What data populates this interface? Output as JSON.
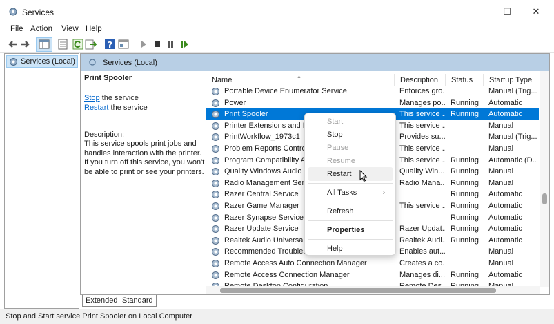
{
  "window": {
    "title": "Services",
    "icon": "services-gear-icon",
    "minimize_icon": "—",
    "maximize_icon": "☐",
    "close_icon": "✕"
  },
  "menu": [
    "File",
    "Action",
    "View",
    "Help"
  ],
  "toolbar": [
    "back-arrow-icon",
    "forward-arrow-icon",
    "console-tree-icon",
    "properties-icon",
    "refresh-icon",
    "export-list-icon",
    "help-icon",
    "view-icon",
    "start-service-icon",
    "stop-service-icon",
    "pause-service-icon",
    "resume-service-icon"
  ],
  "tree": {
    "label": "Services (Local)"
  },
  "pane": {
    "title": "Services (Local)"
  },
  "extended": {
    "service_name": "Print Spooler",
    "stop_link": "Stop",
    "stop_suffix": " the service",
    "restart_link": "Restart",
    "restart_suffix": " the service",
    "description_label": "Description:",
    "description": "This service spools print jobs and handles interaction with the printer. If you turn off this service, you won't be able to print or see your printers."
  },
  "columns": {
    "name": "Name",
    "description": "Description",
    "status": "Status",
    "startup": "Startup Type"
  },
  "rows": [
    {
      "name": "Portable Device Enumerator Service",
      "desc": "Enforces gro...",
      "status": "",
      "startup": "Manual (Trig..."
    },
    {
      "name": "Power",
      "desc": "Manages po...",
      "status": "Running",
      "startup": "Automatic"
    },
    {
      "name": "Print Spooler",
      "desc": "This service ...",
      "status": "Running",
      "startup": "Automatic",
      "selected": true
    },
    {
      "name": "Printer Extensions and Not",
      "desc": "This service ...",
      "status": "",
      "startup": "Manual"
    },
    {
      "name": "PrintWorkflow_1973c1",
      "desc": "Provides su...",
      "status": "",
      "startup": "Manual (Trig..."
    },
    {
      "name": "Problem Reports Control P",
      "desc": "This service ...",
      "status": "",
      "startup": "Manual"
    },
    {
      "name": "Program Compatibility Ass",
      "desc": "This service ...",
      "status": "Running",
      "startup": "Automatic (D..."
    },
    {
      "name": "Quality Windows Audio Vi",
      "desc": "Quality Win...",
      "status": "Running",
      "startup": "Manual"
    },
    {
      "name": "Radio Management Servic",
      "desc": "Radio Mana...",
      "status": "Running",
      "startup": "Manual"
    },
    {
      "name": "Razer Central Service",
      "desc": "",
      "status": "Running",
      "startup": "Automatic"
    },
    {
      "name": "Razer Game Manager",
      "desc": "This service ...",
      "status": "Running",
      "startup": "Automatic"
    },
    {
      "name": "Razer Synapse Service",
      "desc": "",
      "status": "Running",
      "startup": "Automatic"
    },
    {
      "name": "Razer Update Service",
      "desc": "Razer Updat...",
      "status": "Running",
      "startup": "Automatic"
    },
    {
      "name": "Realtek Audio Universal Se",
      "desc": "Realtek Audi...",
      "status": "Running",
      "startup": "Automatic"
    },
    {
      "name": "Recommended Troublesho",
      "desc": "Enables aut...",
      "status": "",
      "startup": "Manual"
    },
    {
      "name": "Remote Access Auto Connection Manager",
      "desc": "Creates a co...",
      "status": "",
      "startup": "Manual"
    },
    {
      "name": "Remote Access Connection Manager",
      "desc": "Manages di...",
      "status": "Running",
      "startup": "Automatic"
    },
    {
      "name": "Remote Desktop Configuration",
      "desc": "Remote Des...",
      "status": "Running",
      "startup": "Manual"
    }
  ],
  "context_menu": {
    "start": "Start",
    "stop": "Stop",
    "pause": "Pause",
    "resume": "Resume",
    "restart": "Restart",
    "all_tasks": "All Tasks",
    "all_tasks_arrow": "›",
    "refresh": "Refresh",
    "properties": "Properties",
    "help": "Help"
  },
  "tabs": {
    "extended": "Extended",
    "standard": "Standard"
  },
  "status": {
    "text": "Stop and Start service Print Spooler on Local Computer"
  },
  "colors": {
    "selection": "#0078d7",
    "header": "#b8cfe5",
    "link": "#0066cc"
  }
}
